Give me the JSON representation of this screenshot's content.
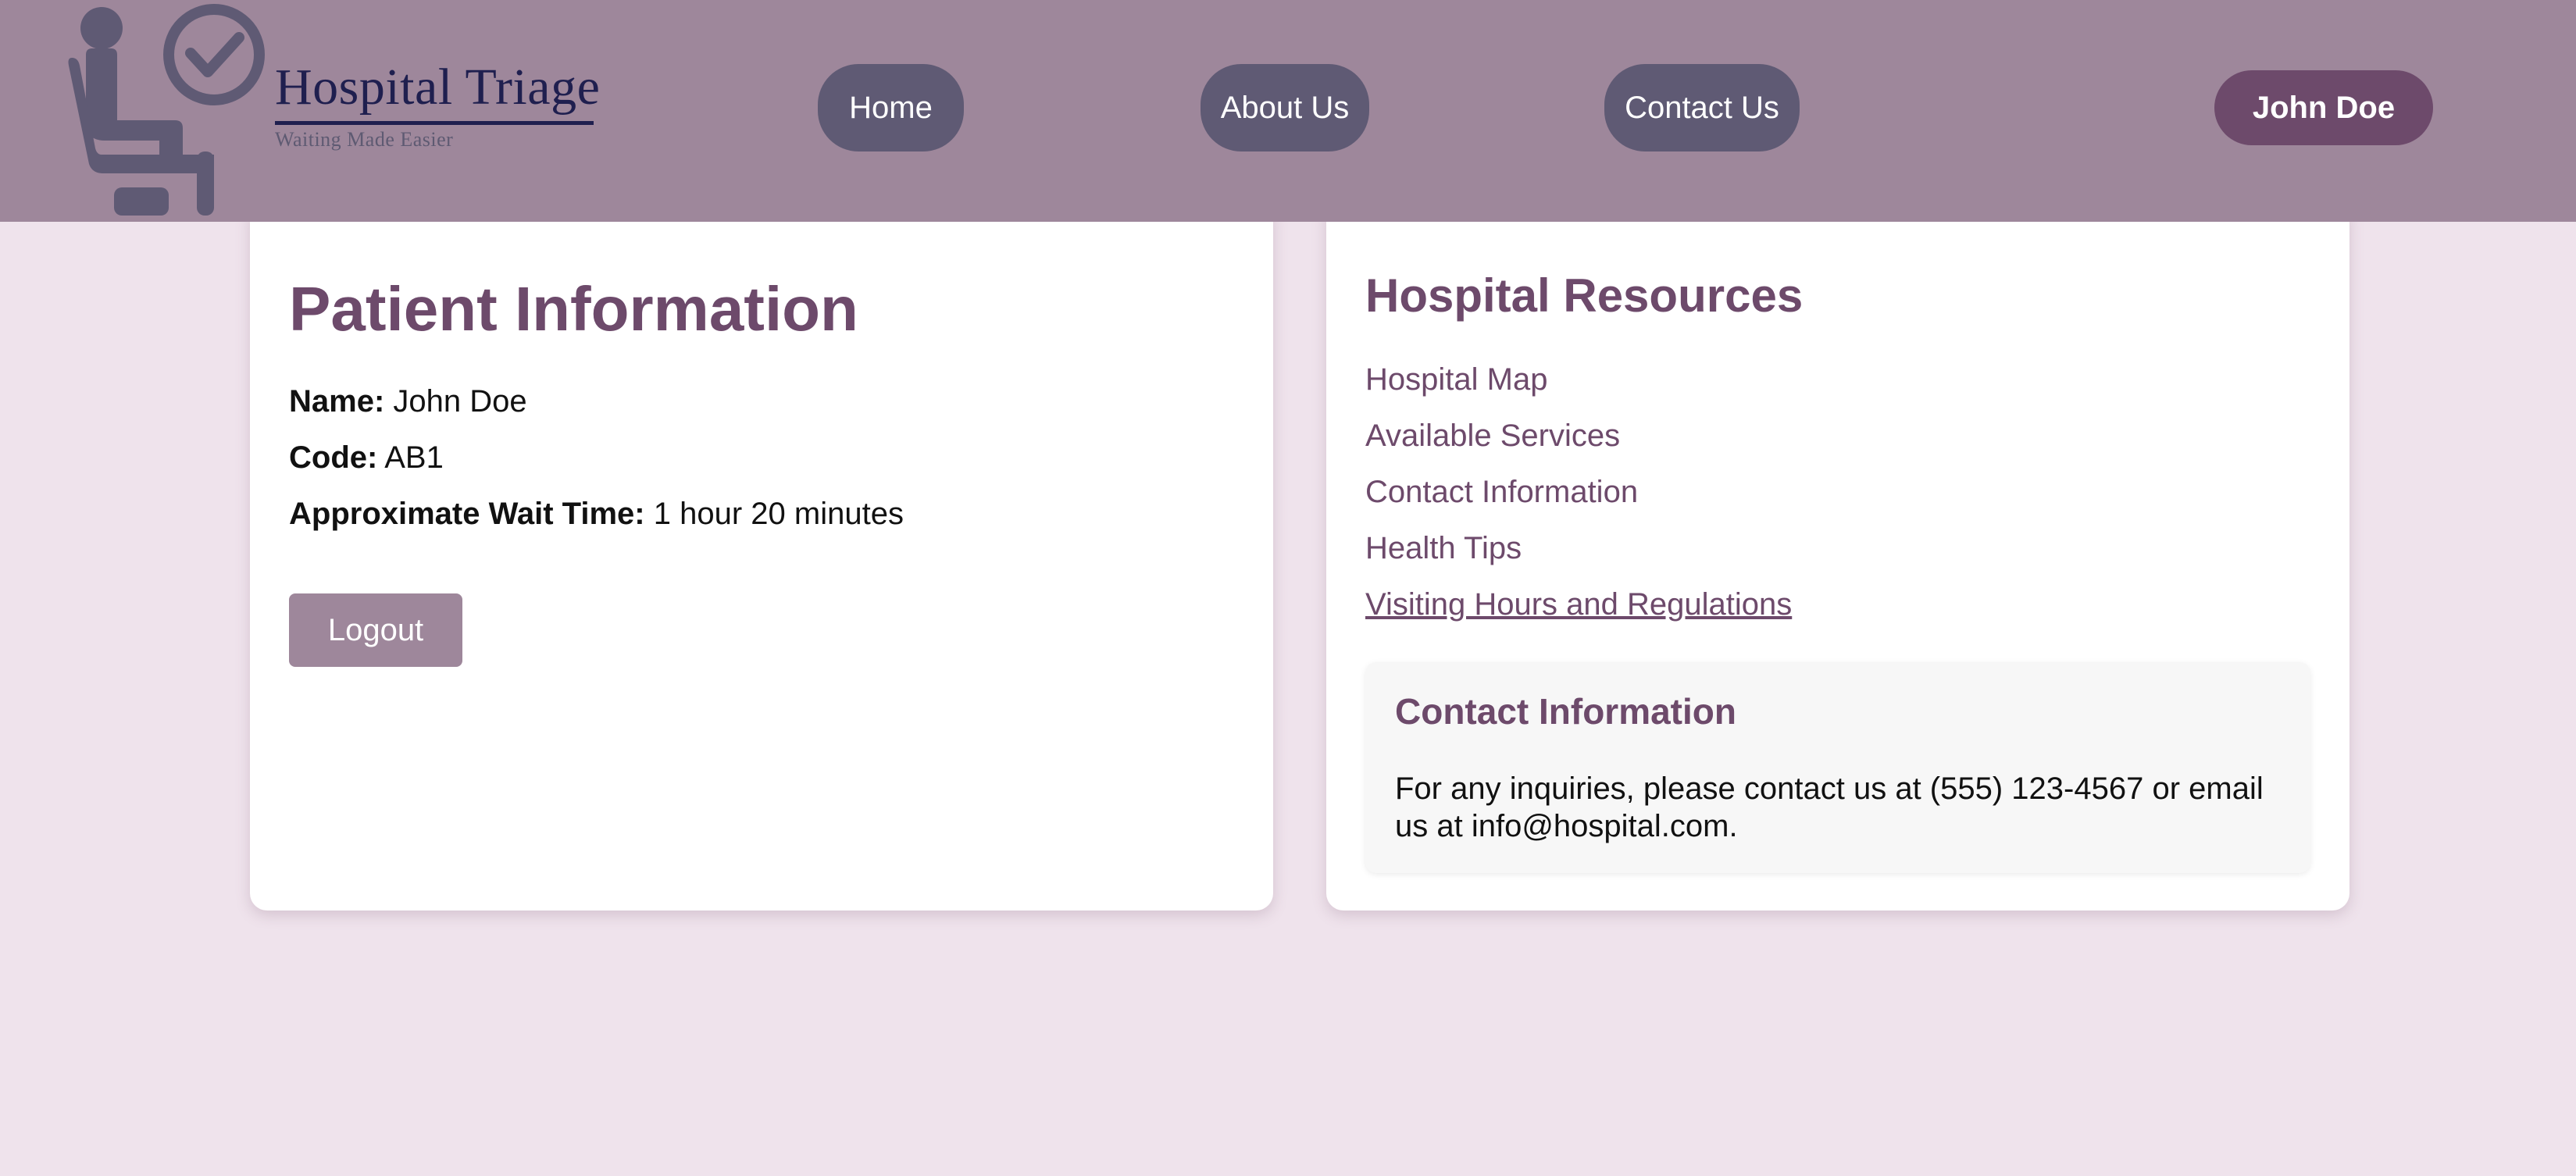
{
  "header": {
    "logo": {
      "title": "Hospital Triage",
      "subtitle": "Waiting Made Easier",
      "icon": "waiting-chair-clock-icon"
    },
    "nav": [
      {
        "label": "Home"
      },
      {
        "label": "About Us"
      },
      {
        "label": "Contact Us"
      }
    ],
    "user_label": "John Doe"
  },
  "patient": {
    "title": "Patient Information",
    "name_label": "Name:",
    "name_value": "John Doe",
    "code_label": "Code:",
    "code_value": "AB1",
    "wait_label": "Approximate Wait Time:",
    "wait_value": "1 hour 20 minutes",
    "logout_label": "Logout"
  },
  "resources": {
    "title": "Hospital Resources",
    "links": [
      {
        "label": "Hospital Map"
      },
      {
        "label": "Available Services"
      },
      {
        "label": "Contact Information"
      },
      {
        "label": "Health Tips"
      },
      {
        "label": "Visiting Hours and Regulations"
      }
    ],
    "contact": {
      "title": "Contact Information",
      "text": "For any inquiries, please contact us at (555) 123-4567 or email us at info@hospital.com."
    }
  },
  "colors": {
    "header_bg": "#9e879b",
    "page_bg": "#efe3ec",
    "nav_button": "#5f5a74",
    "accent": "#6d4a6b",
    "logout_button": "#9e879b"
  }
}
